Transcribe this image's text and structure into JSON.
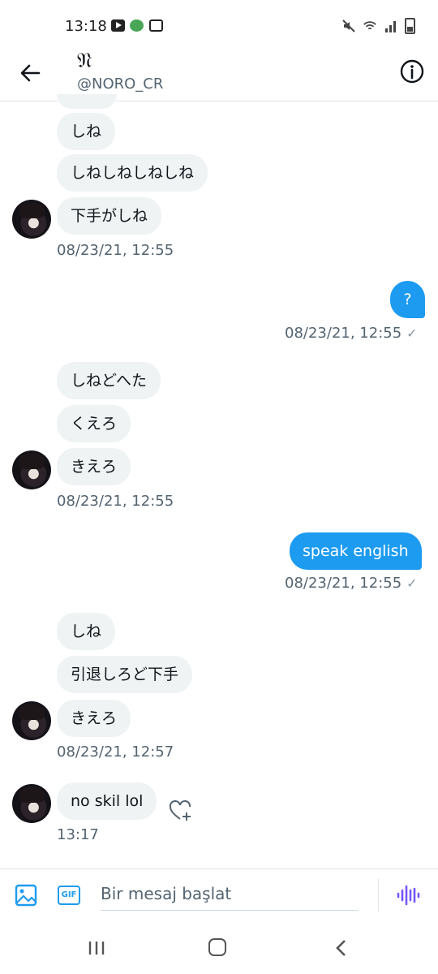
{
  "status_bar": {
    "time": "13:18"
  },
  "header": {
    "name": "𝔑",
    "handle": "@NORO_CR"
  },
  "messages": {
    "g1": {
      "b1": "しね",
      "b2": "しねしねしねしね",
      "b3": "下手がしね",
      "time": "08/23/21, 12:55"
    },
    "o1": {
      "text": "?",
      "time": "08/23/21, 12:55"
    },
    "g2": {
      "b1": "しねどへた",
      "b2": "くえろ",
      "b3": "きえろ",
      "time": "08/23/21, 12:55"
    },
    "o2": {
      "text": "speak english",
      "time": "08/23/21, 12:55"
    },
    "g3": {
      "b1": "しね",
      "b2": "引退しろど下手",
      "b3": "きえろ",
      "time": "08/23/21, 12:57"
    },
    "g4": {
      "b1": "no skil lol",
      "time": "13:17"
    }
  },
  "composer": {
    "placeholder": "Bir mesaj başlat",
    "gif_label": "GIF"
  },
  "colors": {
    "accent": "#1d9bf0",
    "bubble_in": "#eff3f4",
    "voice": "#7856ff"
  },
  "icons": [
    "back-arrow-icon",
    "info-icon",
    "image-icon",
    "gif-icon",
    "voice-icon",
    "heart-plus-icon",
    "check-icon"
  ]
}
